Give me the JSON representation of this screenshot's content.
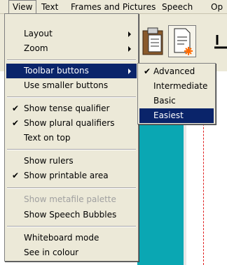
{
  "menubar": {
    "items": [
      "View",
      "Text",
      "Frames and Pictures",
      "Speech",
      "Op"
    ]
  },
  "view_menu": {
    "items": [
      {
        "label": "Layout",
        "submenu": true
      },
      {
        "label": "Zoom",
        "submenu": true
      },
      {
        "label": "Toolbar buttons",
        "submenu": true,
        "highlighted": true
      },
      {
        "label": "Use smaller buttons"
      },
      {
        "label": "Show tense qualifier",
        "checked": true
      },
      {
        "label": "Show plural qualifiers",
        "checked": true
      },
      {
        "label": "Text on top"
      },
      {
        "label": "Show rulers"
      },
      {
        "label": "Show printable area",
        "checked": true
      },
      {
        "label": "Show metafile palette",
        "disabled": true
      },
      {
        "label": "Show Speech Bubbles"
      },
      {
        "label": "Whiteboard mode"
      },
      {
        "label": "See in colour"
      }
    ]
  },
  "toolbar_submenu": {
    "items": [
      {
        "label": "Advanced",
        "checked": true
      },
      {
        "label": "Intermediate"
      },
      {
        "label": "Basic"
      },
      {
        "label": "Easiest",
        "highlighted": true
      }
    ]
  },
  "icons": {
    "check": "✔",
    "paste": "clipboard-icon",
    "doc_star": "document-star-icon",
    "arrow": "arrow-icon"
  },
  "colors": {
    "highlight": "#0a246a",
    "menu_bg": "#ece9d8",
    "canvas_teal": "#0aa7b3",
    "printable_line": "#e02020"
  }
}
